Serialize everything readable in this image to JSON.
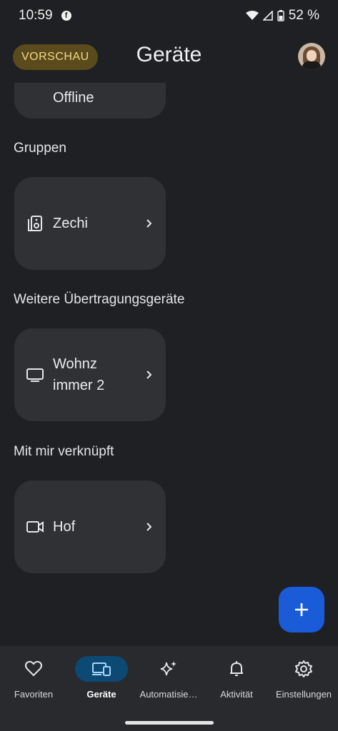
{
  "status_bar": {
    "time": "10:59",
    "battery": "52 %"
  },
  "header": {
    "preview_badge": "VORSCHAU",
    "title": "Geräte"
  },
  "partial_device": {
    "label": "Offline"
  },
  "sections": {
    "groups": {
      "heading": "Gruppen",
      "tile": {
        "label": "Zechi",
        "icon": "speaker-group-icon"
      }
    },
    "cast": {
      "heading": "Weitere Übertragungsgeräte",
      "tile": {
        "label_line1": "Wohnz",
        "label_line2": "immer 2",
        "icon": "tv-icon"
      }
    },
    "linked": {
      "heading": "Mit mir verknüpft",
      "tile": {
        "label": "Hof",
        "icon": "video-camera-icon"
      }
    }
  },
  "fab": {
    "icon": "plus-icon"
  },
  "nav": {
    "items": [
      {
        "label": "Favoriten",
        "icon": "heart-icon"
      },
      {
        "label": "Geräte",
        "icon": "devices-icon",
        "active": true
      },
      {
        "label": "Automatisie…",
        "icon": "sparkle-icon"
      },
      {
        "label": "Aktivität",
        "icon": "bell-icon"
      },
      {
        "label": "Einstellungen",
        "icon": "gear-icon"
      }
    ]
  },
  "colors": {
    "background": "#1f2023",
    "tile": "#303134",
    "accent": "#1a5bd8",
    "active_nav": "#0c4a73",
    "badge_bg": "#5a4a1c",
    "badge_text": "#f4d88a"
  }
}
